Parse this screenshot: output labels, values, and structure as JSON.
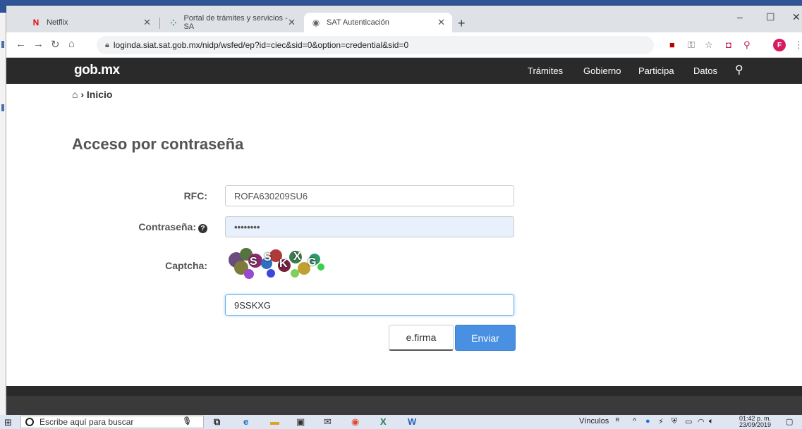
{
  "browser": {
    "tabs": [
      {
        "label": "Netflix",
        "icon": "netflix-icon",
        "color": "#e50914"
      },
      {
        "label": "Portal de trámites y servicios - SA",
        "icon": "sat-portal-icon",
        "color": "#2e7d32"
      },
      {
        "label": "SAT Autenticación",
        "icon": "globe-icon",
        "color": "#5f6368"
      }
    ],
    "new_tab": "+",
    "controls": {
      "minimize": "–",
      "maximize": "☐",
      "close": "✕"
    },
    "url": "loginda.siat.sat.gob.mx/nidp/wsfed/ep?id=ciec&sid=0&option=credential&sid=0",
    "profile_initial": "F"
  },
  "site": {
    "logo": "gob.mx",
    "nav": [
      "Trámites",
      "Gobierno",
      "Participa",
      "Datos"
    ],
    "breadcrumb": "Inicio"
  },
  "form": {
    "title": "Acceso por contraseña",
    "rfc_label": "RFC:",
    "rfc_value": "ROFA630209SU6",
    "password_label": "Contraseña:",
    "password_value": "••••••••",
    "captcha_label": "Captcha:",
    "captcha_chars": [
      "S",
      "S",
      "K",
      "X",
      "G"
    ],
    "captcha_value": "9SSKXG",
    "efirma_label": "e.firma",
    "submit_label": "Enviar"
  },
  "taskbar": {
    "search_placeholder": "Escribe aquí para buscar",
    "vinculos": "Vínculos",
    "time": "01:42 p. m.",
    "date": "23/09/2019"
  }
}
